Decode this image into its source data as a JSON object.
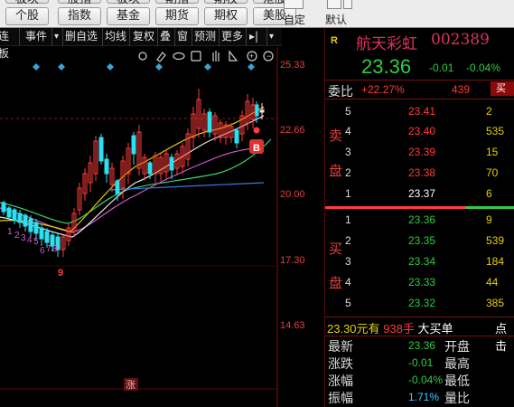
{
  "toolbar": {
    "buttons_row1": [
      "个股",
      "指数",
      "基金",
      "期货",
      "期权",
      "美股"
    ],
    "top_partial": [
      "板块",
      "股指",
      "板块",
      "期指",
      "期权",
      "港股"
    ],
    "custom_label": "自定",
    "default_label": "默认"
  },
  "chart_toolbar": {
    "items": [
      "连板",
      "事件",
      "▾",
      "删自选",
      "均线",
      "复权",
      "叠",
      "窗",
      "预测",
      "更多",
      "▸|",
      "▾"
    ]
  },
  "chart": {
    "price_ticks": [
      "25.33",
      "22.66",
      "20.00",
      "17.30",
      "14.63"
    ],
    "sequence_labels": [
      "1",
      "2",
      "3",
      "4",
      "5",
      "6",
      "7",
      "8"
    ],
    "nine_label": "9",
    "buy_marker": "B",
    "bottom_tag": "涨"
  },
  "quote": {
    "r_badge": "R",
    "name": "航天彩虹",
    "code": "002389",
    "price": "23.36",
    "change": "-0.01",
    "change_pct": "-0.04%",
    "webi_label": "委比",
    "webi_value": "+22.27%",
    "webi_diff": "439",
    "webi_btn": "买",
    "sell_label_1": "卖",
    "sell_label_2": "盘",
    "buy_label_1": "买",
    "buy_label_2": "盘",
    "sell": [
      {
        "level": "5",
        "price": "23.41",
        "vol": "2"
      },
      {
        "level": "4",
        "price": "23.40",
        "vol": "535"
      },
      {
        "level": "3",
        "price": "23.39",
        "vol": "15"
      },
      {
        "level": "2",
        "price": "23.38",
        "vol": "70"
      },
      {
        "level": "1",
        "price": "23.37",
        "vol": "6"
      }
    ],
    "buy": [
      {
        "level": "1",
        "price": "23.36",
        "vol": "9"
      },
      {
        "level": "2",
        "price": "23.35",
        "vol": "539"
      },
      {
        "level": "3",
        "price": "23.34",
        "vol": "184"
      },
      {
        "level": "4",
        "price": "23.33",
        "vol": "44"
      },
      {
        "level": "5",
        "price": "23.32",
        "vol": "385"
      }
    ],
    "big_order_price": "23.30",
    "big_order_unit": "元有",
    "big_order_qty": "938手",
    "big_order_label": "大买单",
    "big_order_link": "点击",
    "stats": [
      {
        "label": "最新",
        "value": "23.36",
        "label2": "开盘"
      },
      {
        "label": "涨跌",
        "value": "-0.01",
        "label2": "最高"
      },
      {
        "label": "涨幅",
        "value": "-0.04%",
        "label2": "最低"
      },
      {
        "label": "振幅",
        "value": "1.71%",
        "label2": "量比"
      }
    ]
  }
}
